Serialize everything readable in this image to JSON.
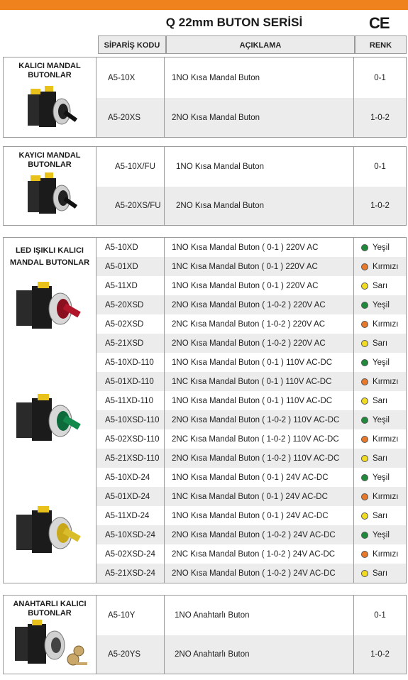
{
  "title": "Q 22mm BUTON SERİSİ",
  "ce_mark": "CE",
  "accent_color": "#f0821e",
  "headers": {
    "code": "SİPARİŞ KODU",
    "desc": "AÇIKLAMA",
    "color": "RENK"
  },
  "section1": {
    "category": [
      "KALICI MANDAL",
      "BUTONLAR"
    ],
    "rows": [
      {
        "code": "A5-10X",
        "desc": "1NO Kısa Mandal Buton",
        "renk": "0-1"
      },
      {
        "code": "A5-20XS",
        "desc": "2NO Kısa Mandal Buton",
        "renk": "1-0-2"
      }
    ]
  },
  "section2": {
    "category": [
      "KAYICI MANDAL",
      "BUTONLAR"
    ],
    "rows": [
      {
        "code": "A5-10X/FU",
        "desc": "1NO Kısa Mandal Buton",
        "renk": "0-1"
      },
      {
        "code": "A5-20XS/FU",
        "desc": "2NO Kısa Mandal Buton",
        "renk": "1-0-2"
      }
    ]
  },
  "section3": {
    "category": [
      "LED IŞIKLI KALICI",
      "MANDAL BUTONLAR"
    ],
    "rows": [
      {
        "code": "A5-10XD",
        "desc": "1NO Kısa Mandal Buton ( 0-1 ) 220V AC",
        "renk": "Yeşil",
        "led": "#1f8a3a"
      },
      {
        "code": "A5-01XD",
        "desc": "1NC Kısa Mandal Buton ( 0-1 ) 220V AC",
        "renk": "Kırmızı",
        "led": "#e8782a"
      },
      {
        "code": "A5-11XD",
        "desc": "1NO Kısa Mandal Buton ( 0-1 ) 220V AC",
        "renk": "Sarı",
        "led": "#f2dc22"
      },
      {
        "code": "A5-20XSD",
        "desc": "2NO Kısa Mandal Buton ( 1-0-2 ) 220V AC",
        "renk": "Yeşil",
        "led": "#1f8a3a"
      },
      {
        "code": "A5-02XSD",
        "desc": "2NC Kısa Mandal Buton ( 1-0-2 ) 220V AC",
        "renk": "Kırmızı",
        "led": "#e8782a"
      },
      {
        "code": "A5-21XSD",
        "desc": "2NO Kısa Mandal Buton ( 1-0-2 ) 220V AC",
        "renk": "Sarı",
        "led": "#f2dc22"
      },
      {
        "code": "A5-10XD-110",
        "desc": "1NO Kısa Mandal Buton ( 0-1 ) 110V AC-DC",
        "renk": "Yeşil",
        "led": "#1f8a3a"
      },
      {
        "code": "A5-01XD-110",
        "desc": "1NC Kısa Mandal Buton ( 0-1 ) 110V AC-DC",
        "renk": "Kırmızı",
        "led": "#e8782a"
      },
      {
        "code": "A5-11XD-110",
        "desc": "1NO Kısa Mandal Buton ( 0-1 ) 110V AC-DC",
        "renk": "Sarı",
        "led": "#f2dc22"
      },
      {
        "code": "A5-10XSD-110",
        "desc": "2NO Kısa Mandal Buton ( 1-0-2 ) 110V AC-DC",
        "renk": "Yeşil",
        "led": "#1f8a3a"
      },
      {
        "code": "A5-02XSD-110",
        "desc": "2NC Kısa Mandal Buton ( 1-0-2 ) 110V AC-DC",
        "renk": "Kırmızı",
        "led": "#e8782a"
      },
      {
        "code": "A5-21XSD-110",
        "desc": "2NO Kısa Mandal Buton ( 1-0-2 ) 110V AC-DC",
        "renk": "Sarı",
        "led": "#f2dc22"
      },
      {
        "code": "A5-10XD-24",
        "desc": "1NO Kısa Mandal Buton ( 0-1 ) 24V AC-DC",
        "renk": "Yeşil",
        "led": "#1f8a3a"
      },
      {
        "code": "A5-01XD-24",
        "desc": "1NC Kısa Mandal Buton ( 0-1 ) 24V AC-DC",
        "renk": "Kırmızı",
        "led": "#e8782a"
      },
      {
        "code": "A5-11XD-24",
        "desc": "1NO Kısa Mandal Buton ( 0-1 ) 24V AC-DC",
        "renk": "Sarı",
        "led": "#f2dc22"
      },
      {
        "code": "A5-10XSD-24",
        "desc": "2NO Kısa Mandal Buton ( 1-0-2 ) 24V AC-DC",
        "renk": "Yeşil",
        "led": "#1f8a3a"
      },
      {
        "code": "A5-02XSD-24",
        "desc": "2NC Kısa Mandal Buton ( 1-0-2 ) 24V AC-DC",
        "renk": "Kırmızı",
        "led": "#e8782a"
      },
      {
        "code": "A5-21XSD-24",
        "desc": "2NO Kısa Mandal Buton ( 1-0-2 ) 24V AC-DC",
        "renk": "Sarı",
        "led": "#f2dc22"
      }
    ]
  },
  "section4": {
    "category": [
      "ANAHTARLI KALICI",
      "BUTONLAR"
    ],
    "rows": [
      {
        "code": "A5-10Y",
        "desc": "1NO Anahtarlı Buton",
        "renk": "0-1"
      },
      {
        "code": "A5-20YS",
        "desc": "2NO Anahtarlı Buton",
        "renk": "1-0-2"
      }
    ]
  }
}
